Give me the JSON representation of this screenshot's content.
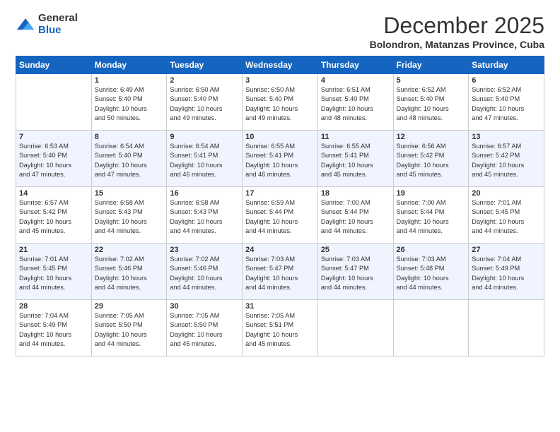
{
  "logo": {
    "general": "General",
    "blue": "Blue"
  },
  "title": "December 2025",
  "subtitle": "Bolondron, Matanzas Province, Cuba",
  "header": {
    "days": [
      "Sunday",
      "Monday",
      "Tuesday",
      "Wednesday",
      "Thursday",
      "Friday",
      "Saturday"
    ]
  },
  "weeks": [
    [
      {
        "day": "",
        "info": ""
      },
      {
        "day": "1",
        "info": "Sunrise: 6:49 AM\nSunset: 5:40 PM\nDaylight: 10 hours\nand 50 minutes."
      },
      {
        "day": "2",
        "info": "Sunrise: 6:50 AM\nSunset: 5:40 PM\nDaylight: 10 hours\nand 49 minutes."
      },
      {
        "day": "3",
        "info": "Sunrise: 6:50 AM\nSunset: 5:40 PM\nDaylight: 10 hours\nand 49 minutes."
      },
      {
        "day": "4",
        "info": "Sunrise: 6:51 AM\nSunset: 5:40 PM\nDaylight: 10 hours\nand 48 minutes."
      },
      {
        "day": "5",
        "info": "Sunrise: 6:52 AM\nSunset: 5:40 PM\nDaylight: 10 hours\nand 48 minutes."
      },
      {
        "day": "6",
        "info": "Sunrise: 6:52 AM\nSunset: 5:40 PM\nDaylight: 10 hours\nand 47 minutes."
      }
    ],
    [
      {
        "day": "7",
        "info": "Sunrise: 6:53 AM\nSunset: 5:40 PM\nDaylight: 10 hours\nand 47 minutes."
      },
      {
        "day": "8",
        "info": "Sunrise: 6:54 AM\nSunset: 5:40 PM\nDaylight: 10 hours\nand 47 minutes."
      },
      {
        "day": "9",
        "info": "Sunrise: 6:54 AM\nSunset: 5:41 PM\nDaylight: 10 hours\nand 46 minutes."
      },
      {
        "day": "10",
        "info": "Sunrise: 6:55 AM\nSunset: 5:41 PM\nDaylight: 10 hours\nand 46 minutes."
      },
      {
        "day": "11",
        "info": "Sunrise: 6:55 AM\nSunset: 5:41 PM\nDaylight: 10 hours\nand 45 minutes."
      },
      {
        "day": "12",
        "info": "Sunrise: 6:56 AM\nSunset: 5:42 PM\nDaylight: 10 hours\nand 45 minutes."
      },
      {
        "day": "13",
        "info": "Sunrise: 6:57 AM\nSunset: 5:42 PM\nDaylight: 10 hours\nand 45 minutes."
      }
    ],
    [
      {
        "day": "14",
        "info": "Sunrise: 6:57 AM\nSunset: 5:42 PM\nDaylight: 10 hours\nand 45 minutes."
      },
      {
        "day": "15",
        "info": "Sunrise: 6:58 AM\nSunset: 5:43 PM\nDaylight: 10 hours\nand 44 minutes."
      },
      {
        "day": "16",
        "info": "Sunrise: 6:58 AM\nSunset: 5:43 PM\nDaylight: 10 hours\nand 44 minutes."
      },
      {
        "day": "17",
        "info": "Sunrise: 6:59 AM\nSunset: 5:44 PM\nDaylight: 10 hours\nand 44 minutes."
      },
      {
        "day": "18",
        "info": "Sunrise: 7:00 AM\nSunset: 5:44 PM\nDaylight: 10 hours\nand 44 minutes."
      },
      {
        "day": "19",
        "info": "Sunrise: 7:00 AM\nSunset: 5:44 PM\nDaylight: 10 hours\nand 44 minutes."
      },
      {
        "day": "20",
        "info": "Sunrise: 7:01 AM\nSunset: 5:45 PM\nDaylight: 10 hours\nand 44 minutes."
      }
    ],
    [
      {
        "day": "21",
        "info": "Sunrise: 7:01 AM\nSunset: 5:45 PM\nDaylight: 10 hours\nand 44 minutes."
      },
      {
        "day": "22",
        "info": "Sunrise: 7:02 AM\nSunset: 5:46 PM\nDaylight: 10 hours\nand 44 minutes."
      },
      {
        "day": "23",
        "info": "Sunrise: 7:02 AM\nSunset: 5:46 PM\nDaylight: 10 hours\nand 44 minutes."
      },
      {
        "day": "24",
        "info": "Sunrise: 7:03 AM\nSunset: 5:47 PM\nDaylight: 10 hours\nand 44 minutes."
      },
      {
        "day": "25",
        "info": "Sunrise: 7:03 AM\nSunset: 5:47 PM\nDaylight: 10 hours\nand 44 minutes."
      },
      {
        "day": "26",
        "info": "Sunrise: 7:03 AM\nSunset: 5:48 PM\nDaylight: 10 hours\nand 44 minutes."
      },
      {
        "day": "27",
        "info": "Sunrise: 7:04 AM\nSunset: 5:49 PM\nDaylight: 10 hours\nand 44 minutes."
      }
    ],
    [
      {
        "day": "28",
        "info": "Sunrise: 7:04 AM\nSunset: 5:49 PM\nDaylight: 10 hours\nand 44 minutes."
      },
      {
        "day": "29",
        "info": "Sunrise: 7:05 AM\nSunset: 5:50 PM\nDaylight: 10 hours\nand 44 minutes."
      },
      {
        "day": "30",
        "info": "Sunrise: 7:05 AM\nSunset: 5:50 PM\nDaylight: 10 hours\nand 45 minutes."
      },
      {
        "day": "31",
        "info": "Sunrise: 7:05 AM\nSunset: 5:51 PM\nDaylight: 10 hours\nand 45 minutes."
      },
      {
        "day": "",
        "info": ""
      },
      {
        "day": "",
        "info": ""
      },
      {
        "day": "",
        "info": ""
      }
    ]
  ]
}
